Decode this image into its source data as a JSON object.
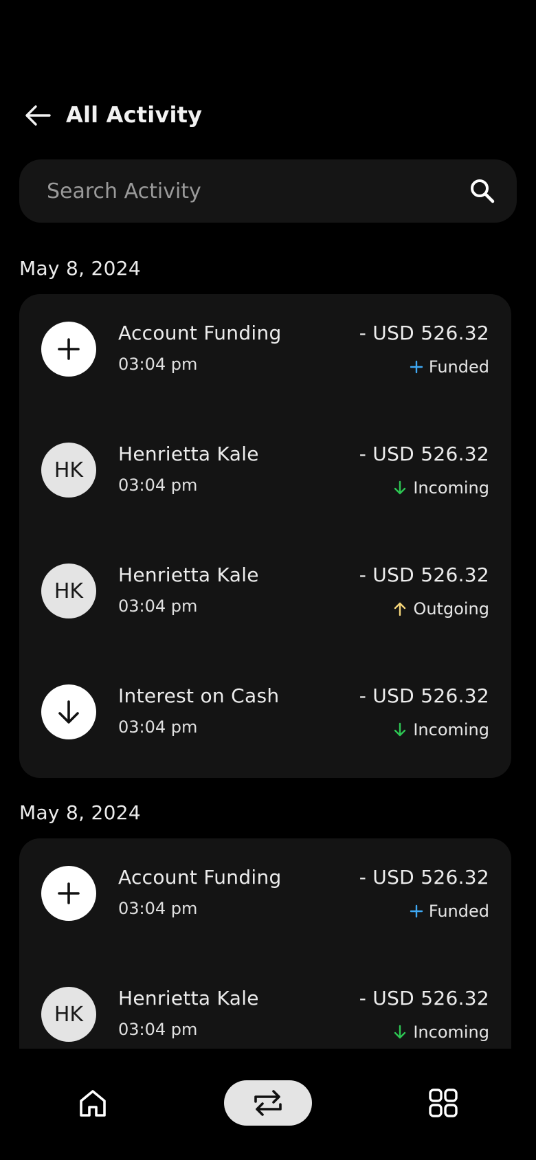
{
  "header": {
    "title": "All Activity",
    "back_icon": "arrow-left-icon"
  },
  "search": {
    "placeholder": "Search Activity",
    "value": "",
    "icon": "search-icon"
  },
  "colors": {
    "background": "#000000",
    "card": "#141414",
    "funded": "#3fa9f5",
    "incoming": "#2dc653",
    "outgoing": "#f5d57a"
  },
  "groups": [
    {
      "date": "May 8, 2024",
      "items": [
        {
          "avatar_type": "icon",
          "avatar_icon": "plus-icon",
          "name": "Account Funding",
          "time": "03:04 pm",
          "amount": "- USD 526.32",
          "status": "Funded",
          "status_icon": "plus-icon"
        },
        {
          "avatar_type": "initials",
          "initials": "HK",
          "name": "Henrietta Kale",
          "time": "03:04 pm",
          "amount": "- USD 526.32",
          "status": "Incoming",
          "status_icon": "arrow-down-icon"
        },
        {
          "avatar_type": "initials",
          "initials": "HK",
          "name": "Henrietta Kale",
          "time": "03:04 pm",
          "amount": "- USD 526.32",
          "status": "Outgoing",
          "status_icon": "arrow-up-icon"
        },
        {
          "avatar_type": "icon",
          "avatar_icon": "arrow-down-icon",
          "name": "Interest on Cash",
          "time": "03:04 pm",
          "amount": "- USD 526.32",
          "status": "Incoming",
          "status_icon": "arrow-down-icon"
        }
      ]
    },
    {
      "date": "May 8, 2024",
      "items": [
        {
          "avatar_type": "icon",
          "avatar_icon": "plus-icon",
          "name": "Account Funding",
          "time": "03:04 pm",
          "amount": "- USD 526.32",
          "status": "Funded",
          "status_icon": "plus-icon"
        },
        {
          "avatar_type": "initials",
          "initials": "HK",
          "name": "Henrietta Kale",
          "time": "03:04 pm",
          "amount": "- USD 526.32",
          "status": "Incoming",
          "status_icon": "arrow-down-icon"
        }
      ]
    }
  ],
  "bottom_nav": {
    "items": [
      {
        "icon": "home-icon",
        "active": false
      },
      {
        "icon": "swap-icon",
        "active": true
      },
      {
        "icon": "apps-grid-icon",
        "active": false
      }
    ]
  }
}
